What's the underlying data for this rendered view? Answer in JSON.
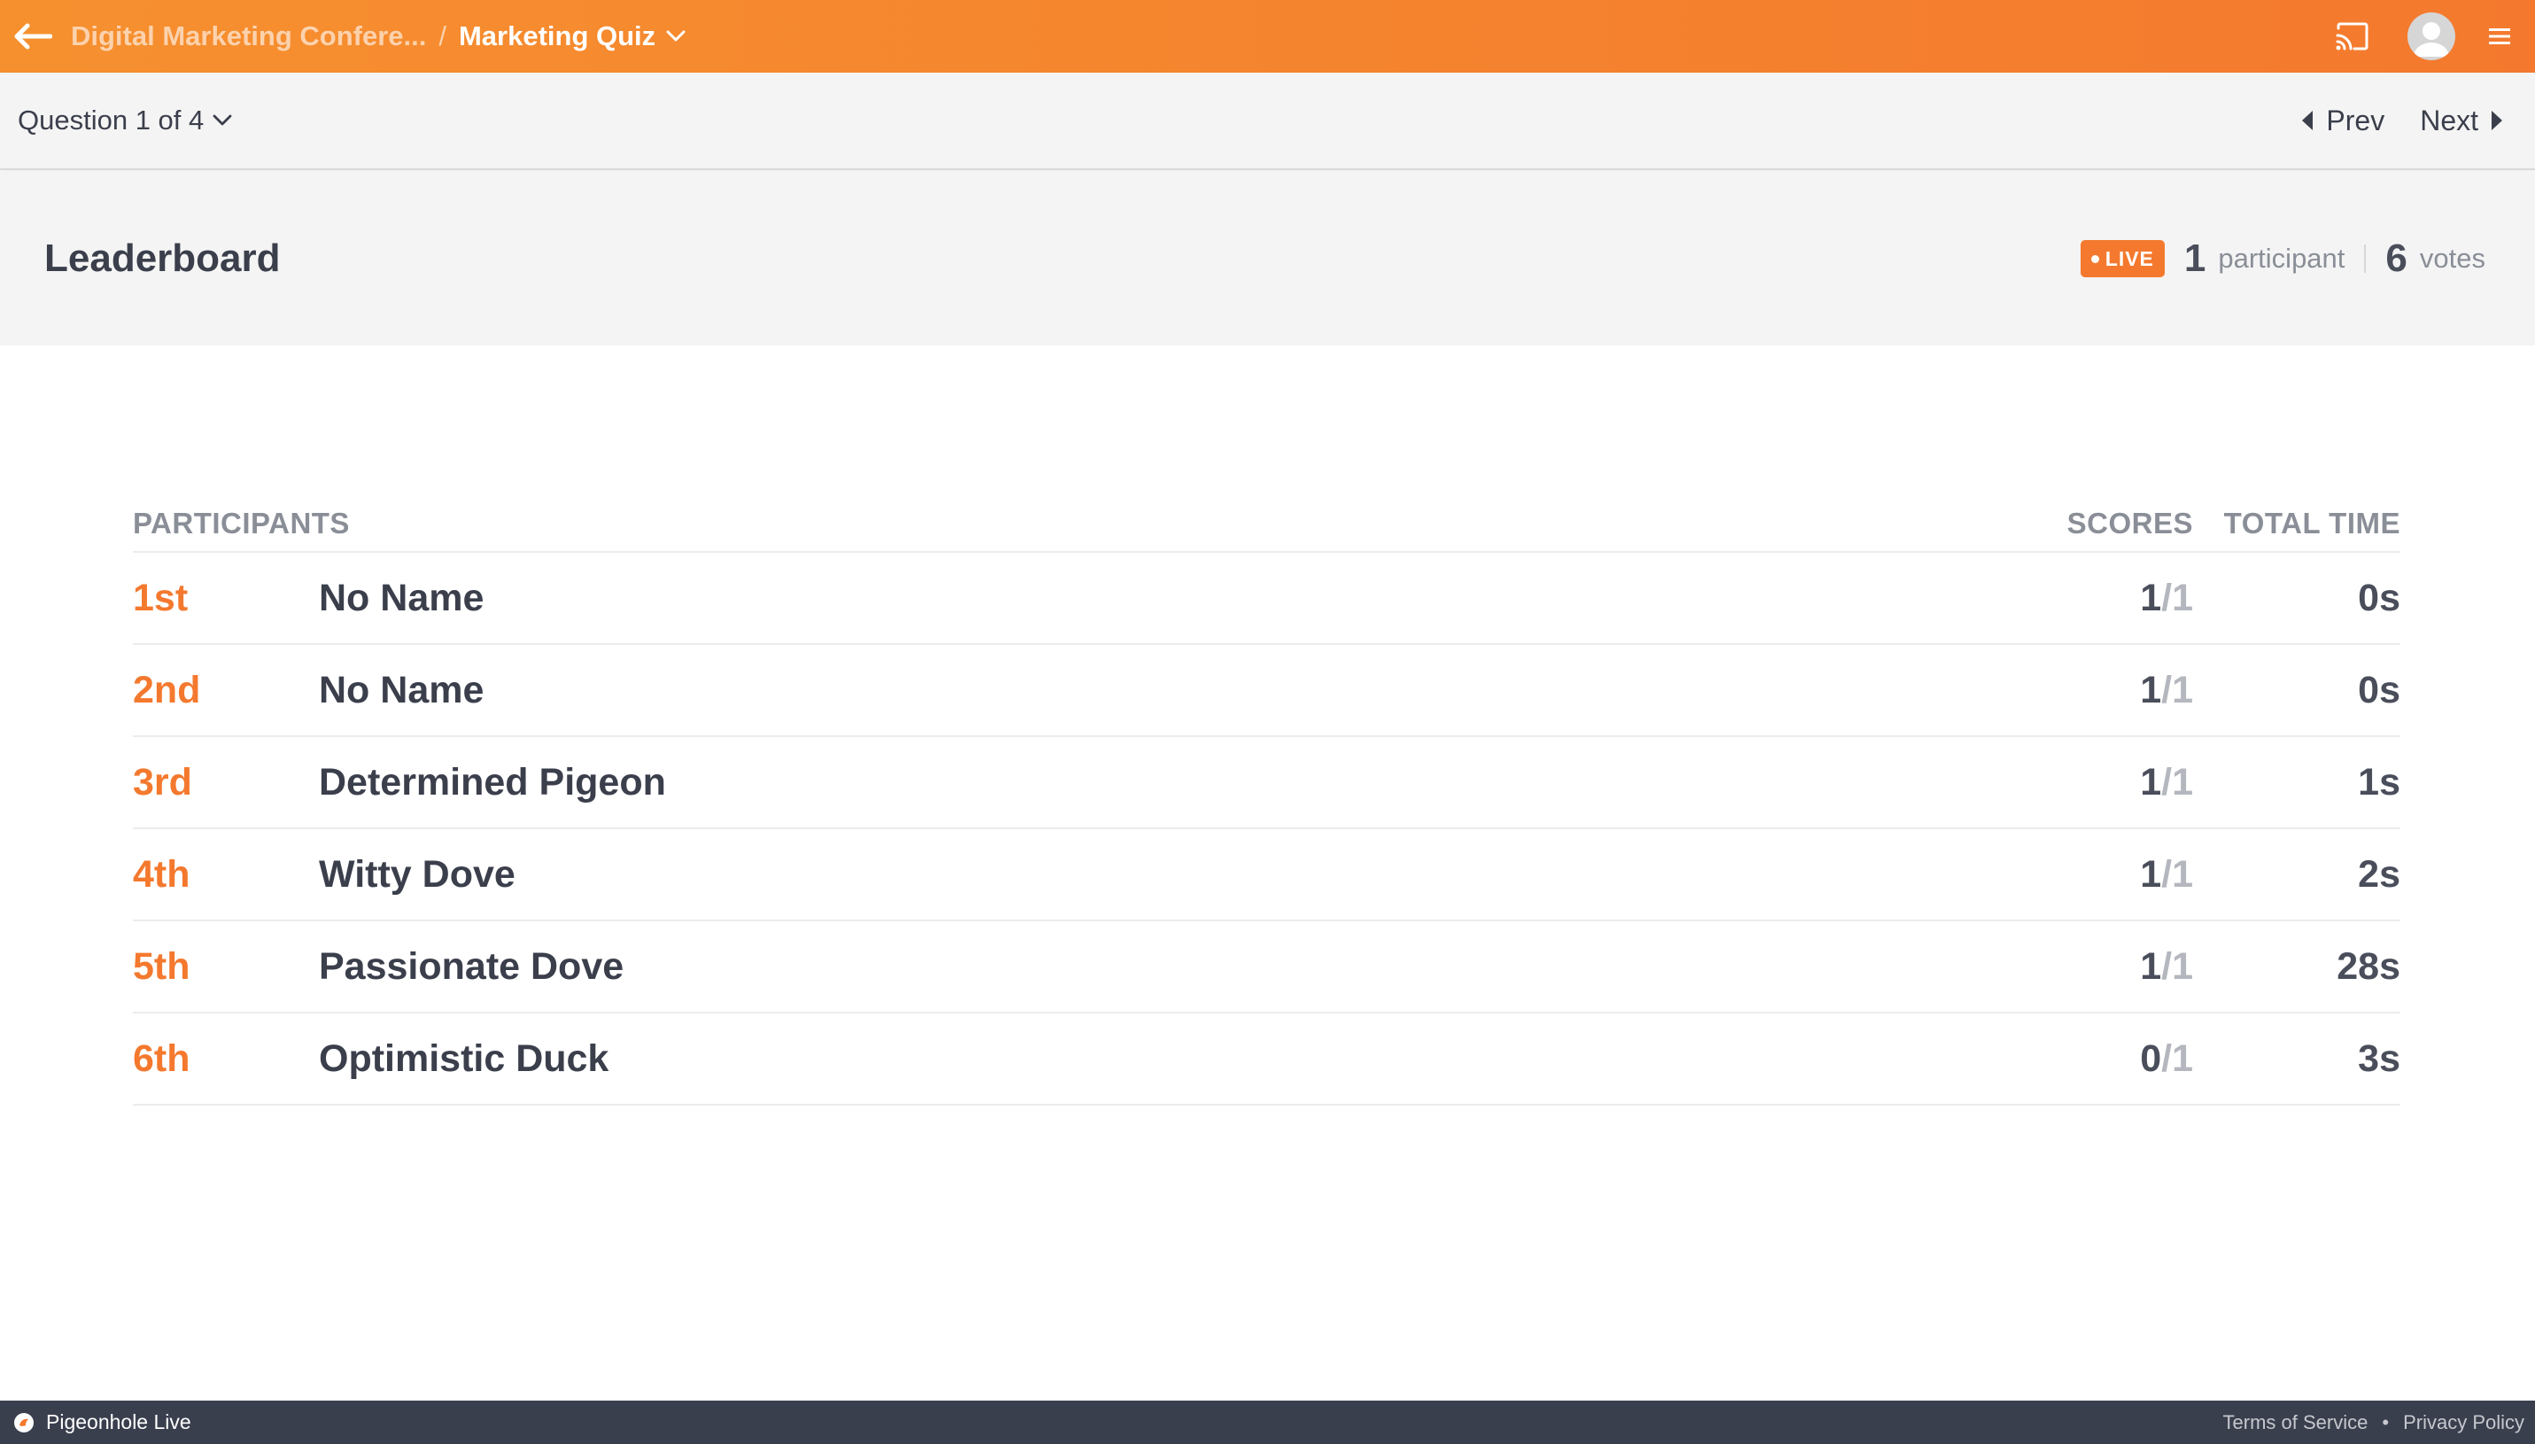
{
  "topbar": {
    "back_icon": "arrow-left-icon",
    "breadcrumb_parent": "Digital Marketing Confere...",
    "breadcrumb_separator": "/",
    "breadcrumb_current": "Marketing Quiz",
    "accent_color": "#f4792e"
  },
  "subbar": {
    "question_selector": "Question 1 of 4",
    "prev_label": "Prev",
    "next_label": "Next"
  },
  "header": {
    "title": "Leaderboard",
    "live_label": "LIVE",
    "participant_count": "1",
    "participant_label": "participant",
    "vote_count": "6",
    "vote_label": "votes"
  },
  "table": {
    "columns": {
      "participants": "PARTICIPANTS",
      "scores": "SCORES",
      "total_time": "TOTAL TIME"
    },
    "rows": [
      {
        "rank": "1st",
        "name": "No Name",
        "score": "1",
        "score_total": "/1",
        "time": "0s"
      },
      {
        "rank": "2nd",
        "name": "No Name",
        "score": "1",
        "score_total": "/1",
        "time": "0s"
      },
      {
        "rank": "3rd",
        "name": "Determined Pigeon",
        "score": "1",
        "score_total": "/1",
        "time": "1s"
      },
      {
        "rank": "4th",
        "name": "Witty Dove",
        "score": "1",
        "score_total": "/1",
        "time": "2s"
      },
      {
        "rank": "5th",
        "name": "Passionate Dove",
        "score": "1",
        "score_total": "/1",
        "time": "28s"
      },
      {
        "rank": "6th",
        "name": "Optimistic Duck",
        "score": "0",
        "score_total": "/1",
        "time": "3s"
      }
    ]
  },
  "footer": {
    "brand": "Pigeonhole Live",
    "terms": "Terms of Service",
    "separator": "•",
    "privacy": "Privacy Policy"
  }
}
